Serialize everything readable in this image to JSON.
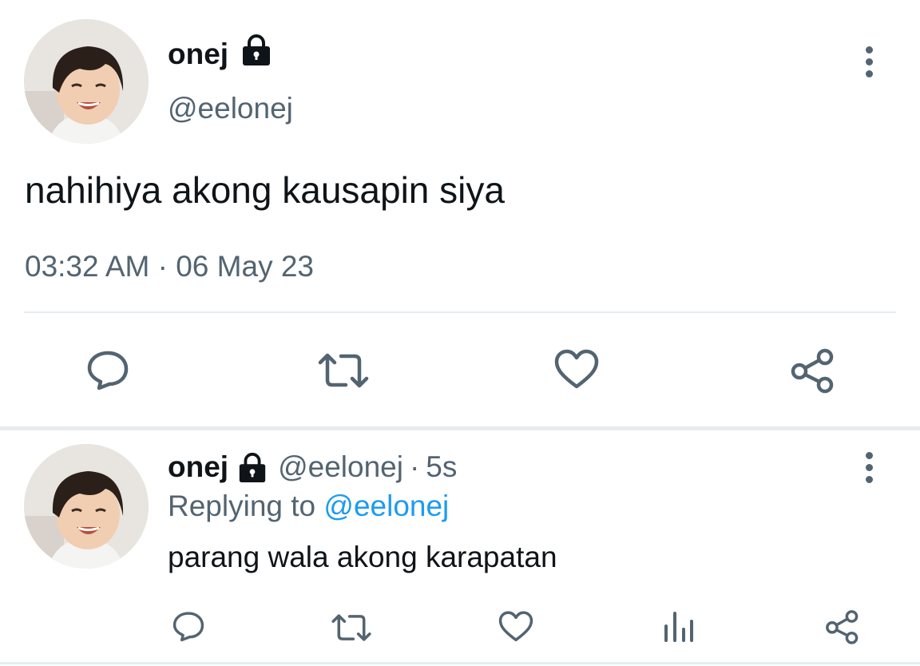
{
  "main_tweet": {
    "display_name": "onej",
    "handle": "@eelonej",
    "text": "nahihiya akong kausapin siya",
    "time": "03:32 AM",
    "separator": "·",
    "date": "06 May 23",
    "avatar": "avatar-photo-child-smiling",
    "actions": [
      "reply-icon",
      "retweet-icon",
      "like-icon",
      "share-icon"
    ]
  },
  "reply_tweet": {
    "display_name": "onej",
    "handle": "@eelonej",
    "separator": "·",
    "age": "5s",
    "replying_prefix": "Replying to",
    "replying_to": "@eelonej",
    "text": "parang wala akong karapatan",
    "avatar": "avatar-photo-child-smiling",
    "actions": [
      "reply-icon",
      "retweet-icon",
      "like-icon",
      "analytics-icon",
      "share-icon"
    ]
  },
  "colors": {
    "text": "#0f1419",
    "muted": "#536471",
    "link": "#1d9bf0",
    "divider": "#e6ecf0"
  }
}
